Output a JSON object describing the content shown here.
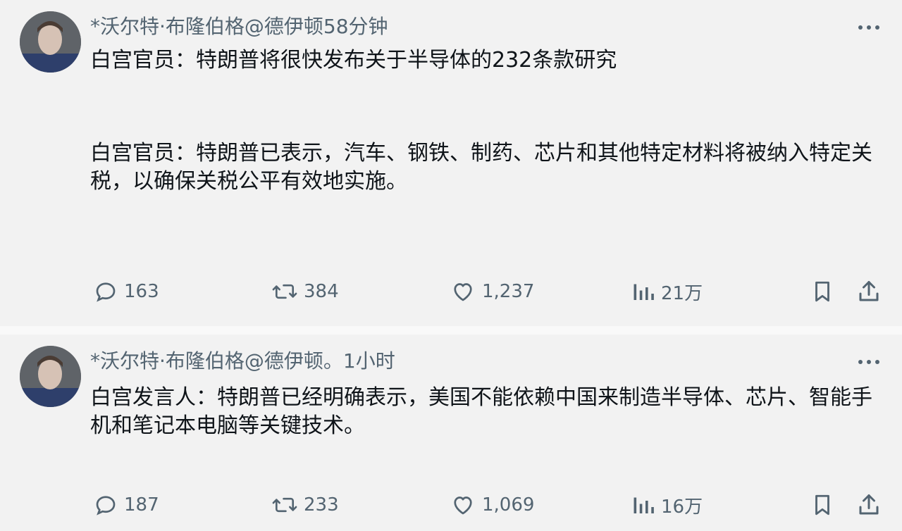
{
  "posts": [
    {
      "author": "*沃尔特·布隆伯格@德伊顿",
      "time": "58分钟",
      "paragraphs": [
        "白宫官员：特朗普将很快发布关于半导体的232条款研究",
        "白宫官员：特朗普已表示，汽车、钢铁、制药、芯片和其他特定材料将被纳入特定关税，以确保关税公平有效地实施。"
      ],
      "stats": {
        "replies": "163",
        "reposts": "384",
        "likes": "1,237",
        "views": "21万"
      }
    },
    {
      "author": "*沃尔特·布隆伯格@德伊顿。",
      "time": "1小时",
      "paragraphs": [
        "白宫发言人：特朗普已经明确表示，美国不能依赖中国来制造半导体、芯片、智能手机和笔记本电脑等关键技术。"
      ],
      "stats": {
        "replies": "187",
        "reposts": "233",
        "likes": "1,069",
        "views": "16万"
      }
    }
  ],
  "icons": {
    "reply": "reply-icon",
    "repost": "repost-icon",
    "like": "heart-icon",
    "views": "views-icon",
    "bookmark": "bookmark-icon",
    "share": "share-icon",
    "more": "more-icon"
  },
  "colors": {
    "background": "#f2f2f2",
    "text": "#0f1419",
    "muted": "#536471"
  }
}
